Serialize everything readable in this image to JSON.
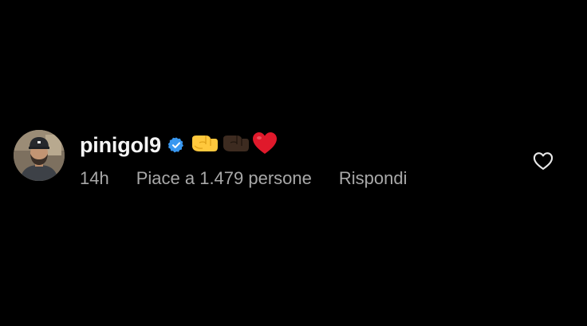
{
  "comment": {
    "username": "pinigol9",
    "verified": true,
    "emojis": [
      "fist-right-light-icon",
      "fist-right-dark-icon",
      "red-heart-icon"
    ],
    "time": "14h",
    "likes_label": "Piace a 1.479 persone",
    "reply_label": "Rispondi"
  },
  "colors": {
    "background": "#000000",
    "username": "#f5f5f5",
    "meta": "#a8a8a8",
    "verified": "#3897f0",
    "heart": "#e0192b"
  },
  "icons": {
    "like": "heart-outline-icon",
    "verified": "verified-badge-icon"
  }
}
